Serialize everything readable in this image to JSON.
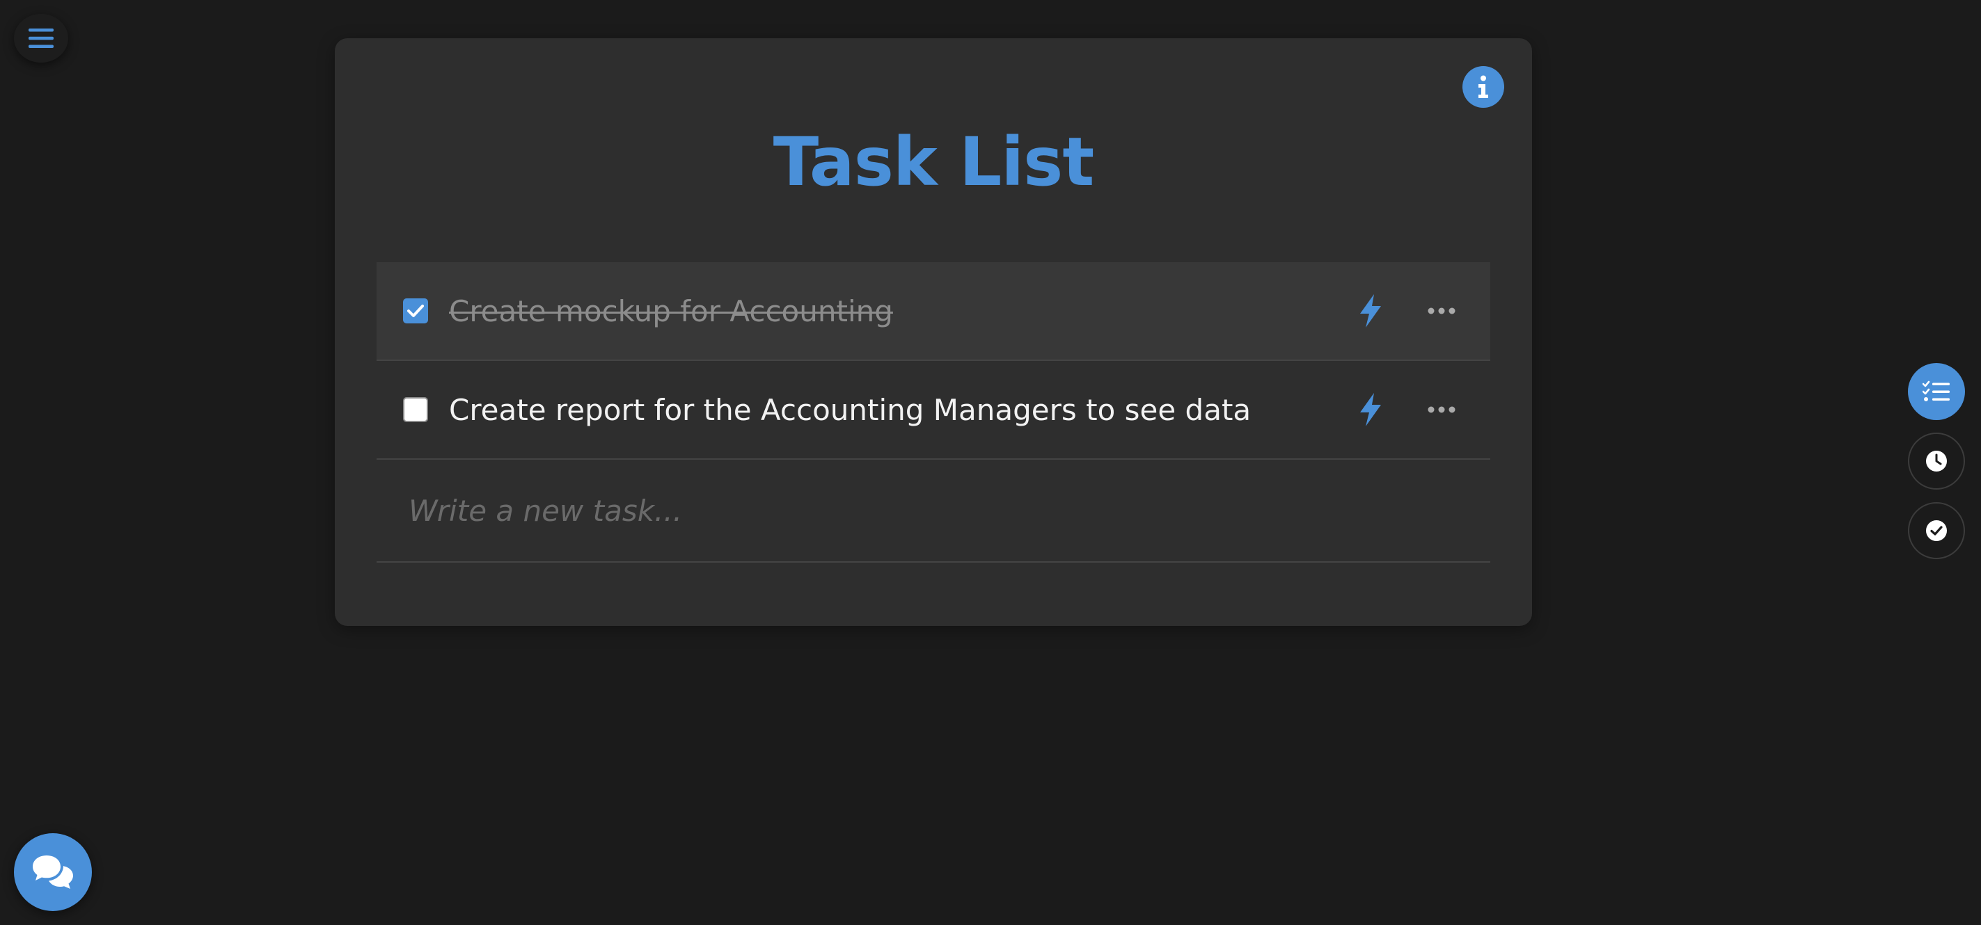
{
  "header": {
    "title": "Task List"
  },
  "tasks": [
    {
      "text": "Create mockup for Accounting",
      "completed": true
    },
    {
      "text": "Create report for the Accounting Managers to see data",
      "completed": false
    }
  ],
  "new_task": {
    "placeholder": "Write a new task...",
    "value": ""
  },
  "icons": {
    "menu": "hamburger-menu-icon",
    "info": "info-icon",
    "priority": "lightning-bolt-icon",
    "more": "ellipsis-icon",
    "tasks_view": "checklist-icon",
    "history_view": "clock-icon",
    "completed_view": "check-circle-icon",
    "chat": "chat-bubbles-icon"
  },
  "colors": {
    "accent": "#4a90d9",
    "background": "#1b1b1b",
    "card": "#2e2e2e",
    "completed_row": "#383838"
  }
}
